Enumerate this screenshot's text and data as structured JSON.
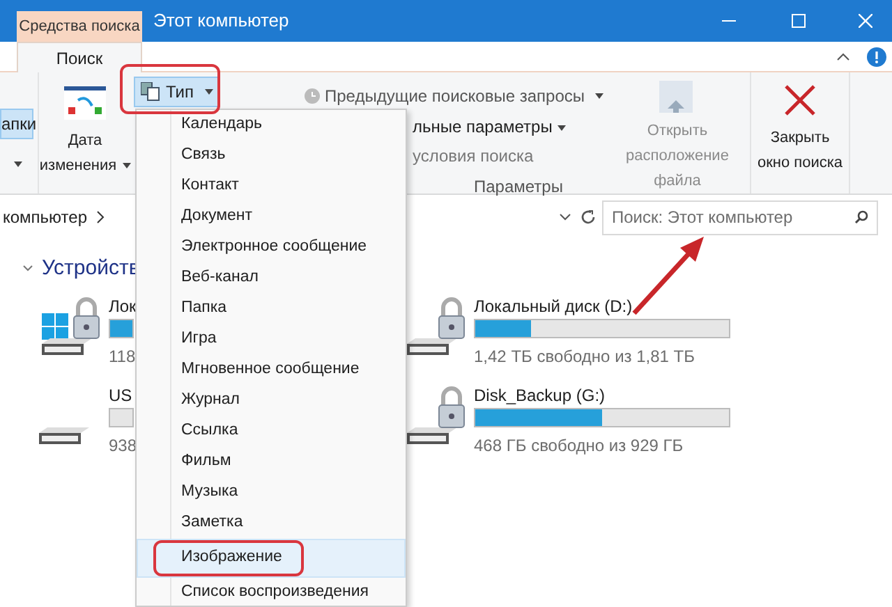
{
  "window": {
    "context_tab": "Средства поиска",
    "title": "Этот компьютер"
  },
  "ribbon_tabs": [
    {
      "label": "Поиск",
      "selected": true
    }
  ],
  "ribbon": {
    "folders_button": {
      "label": "апки",
      "selected": true
    },
    "date_button": "Дата изменения",
    "type_button": {
      "label": "Тип",
      "selected": true
    },
    "previous_searches": "Предыдущие поисковые запросы",
    "advanced_options": "льные параметры",
    "save_search": "условия поиска",
    "group_label": "Параметры",
    "open_location": {
      "label": "Открыть расположение файла",
      "disabled": true
    },
    "close_search": "Закрыть окно поиска"
  },
  "address": {
    "path": "компьютер"
  },
  "search": {
    "placeholder": "Поиск: Этот компьютер"
  },
  "section": {
    "label": "Устройств",
    "expanded": true
  },
  "drives": [
    {
      "kind": "system",
      "name": "Лок",
      "level": 1,
      "reading": "118"
    },
    {
      "kind": "usb",
      "name": "US",
      "level": 0,
      "reading": "938"
    },
    {
      "kind": "locked",
      "name": "Локальный диск (D:)",
      "level": 0.22,
      "reading": "1,42 ТБ свободно из 1,81 ТБ"
    },
    {
      "kind": "locked",
      "name": "Disk_Backup (G:)",
      "level": 0.5,
      "reading": "468 ГБ свободно из 929 ГБ"
    }
  ],
  "type_menu": [
    {
      "label": "Календарь",
      "selected": false
    },
    {
      "label": "Связь",
      "selected": false
    },
    {
      "label": "Контакт",
      "selected": false
    },
    {
      "label": "Документ",
      "selected": false
    },
    {
      "label": "Электронное сообщение",
      "selected": false
    },
    {
      "label": "Веб-канал",
      "selected": false
    },
    {
      "label": "Папка",
      "selected": false
    },
    {
      "label": "Игра",
      "selected": false
    },
    {
      "label": "Мгновенное сообщение",
      "selected": false
    },
    {
      "label": "Журнал",
      "selected": false
    },
    {
      "label": "Ссылка",
      "selected": false
    },
    {
      "label": "Фильм",
      "selected": false
    },
    {
      "label": "Музыка",
      "selected": false
    },
    {
      "label": "Заметка",
      "selected": false
    },
    {
      "label": "Изображение",
      "selected": true
    },
    {
      "label": "Список воспроизведения",
      "selected": false
    }
  ]
}
